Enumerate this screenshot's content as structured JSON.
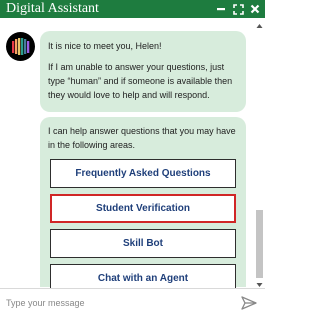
{
  "window": {
    "title": "Digital Assistant",
    "controls": {
      "minimize_icon": "minimize-icon",
      "expand_icon": "expand-icon",
      "close_icon": "close-icon"
    },
    "titlebar_color": "#1e7c3f"
  },
  "messages": {
    "greeting": "It is nice to meet you, Helen!",
    "fallback": "If I am unable to answer your questions, just type “human” and if someone is available then they would love to help and will respond.",
    "intro": "I can help answer questions that you may have in the following areas."
  },
  "options": [
    {
      "label": "Frequently Asked Questions"
    },
    {
      "label": "Student Verification"
    },
    {
      "label": "Skill Bot"
    },
    {
      "label": "Chat with an Agent"
    }
  ],
  "input": {
    "placeholder": "Type your message",
    "value": ""
  },
  "colors": {
    "bubble": "#d7ecdc",
    "button_text": "#1f3f7a",
    "selected_border": "#d02626"
  }
}
